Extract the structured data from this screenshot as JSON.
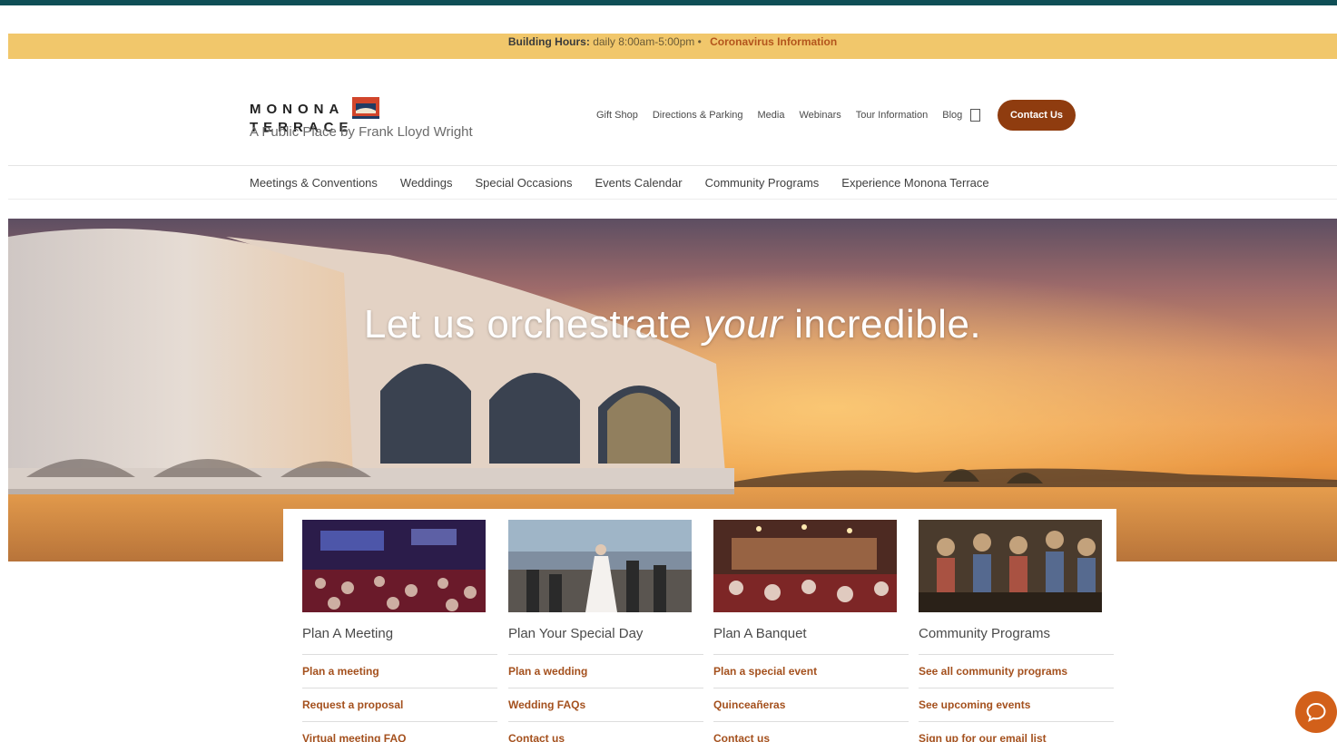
{
  "alert": {
    "hours_label": "Building Hours:",
    "hours_value": "daily 8:00am-5:00pm •",
    "covid_link": "Coronavirus Information"
  },
  "brand": {
    "wordmark_left": "MONONA",
    "wordmark_right": "TERRACE",
    "tagline": "A Public Place by Frank Lloyd Wright"
  },
  "utility_nav": [
    "Gift Shop",
    "Directions & Parking",
    "Media",
    "Webinars",
    "Tour Information",
    "Blog"
  ],
  "contact_button": "Contact Us",
  "main_nav": [
    "Meetings & Conventions",
    "Weddings",
    "Special Occasions",
    "Events Calendar",
    "Community Programs",
    "Experience Monona Terrace"
  ],
  "hero": {
    "headline_before": "Let us orchestrate ",
    "headline_em": "your",
    "headline_after": " incredible."
  },
  "cards": [
    {
      "title": "Plan A Meeting",
      "links": [
        "Plan a meeting",
        "Request a proposal",
        "Virtual meeting FAQ"
      ]
    },
    {
      "title": "Plan Your Special Day",
      "links": [
        "Plan a wedding",
        "Wedding FAQs",
        "Contact us"
      ]
    },
    {
      "title": "Plan A Banquet",
      "links": [
        "Plan a special event",
        "Quinceañeras",
        "Contact us"
      ]
    },
    {
      "title": "Community Programs",
      "links": [
        "See all community programs",
        "See upcoming events",
        "Sign up for our email list"
      ]
    }
  ],
  "colors": {
    "accent": "#8f3c0f",
    "link": "#a4501d",
    "alert_bg": "#f1c76b",
    "chat": "#d2601a"
  },
  "icons": {
    "search": "search-icon",
    "chat": "chat-icon"
  }
}
